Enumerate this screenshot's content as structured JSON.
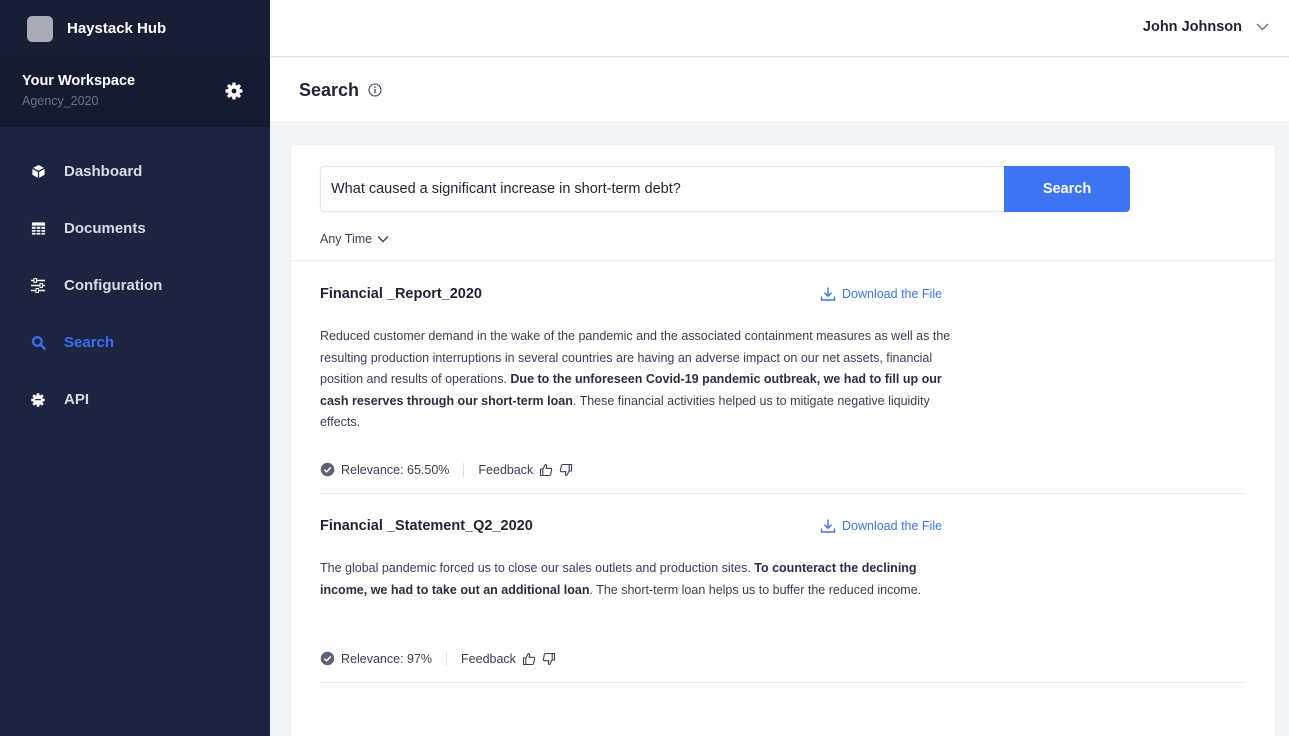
{
  "brand": {
    "name": "Haystack Hub"
  },
  "workspace": {
    "title": "Your Workspace",
    "subtitle": "Agency_2020"
  },
  "nav": [
    {
      "label": "Dashboard",
      "icon": "cube-icon"
    },
    {
      "label": "Documents",
      "icon": "table-icon"
    },
    {
      "label": "Configuration",
      "icon": "sliders-icon"
    },
    {
      "label": "Search",
      "icon": "search-icon",
      "active": true
    },
    {
      "label": "API",
      "icon": "gear-icon"
    }
  ],
  "user": {
    "name": "John Johnson"
  },
  "page": {
    "title": "Search"
  },
  "search": {
    "query": "What caused a significant increase in short-term debt?",
    "button_label": "Search",
    "time_filter": "Any Time"
  },
  "results": [
    {
      "title": "Financial _Report_2020",
      "download_label": "Download the File",
      "body_pre": "Reduced customer demand in the wake of the pandemic and the associated containment measures as well as the resulting production interruptions in several countries are having an adverse impact on our net assets, financial position and results of operations. ",
      "body_bold": "Due to the unforeseen Covid-19 pandemic outbreak, we had to fill up our cash reserves through our short-term loan",
      "body_post": ". These financial activities helped us to mitigate negative liquidity effects.",
      "relevance": "Relevance: 65.50%",
      "feedback_label": "Feedback"
    },
    {
      "title": "Financial _Statement_Q2_2020",
      "download_label": "Download the File",
      "body_pre": "The global pandemic forced us to close our sales outlets and production sites. ",
      "body_bold": "To counteract the declining income, we had to take out an additional loan",
      "body_post": ". The short-term loan helps us to buffer the reduced income.",
      "relevance": "Relevance: 97%",
      "feedback_label": "Feedback"
    }
  ],
  "colors": {
    "sidebar": "#1c2440",
    "accent": "#3d74f6",
    "active_nav": "#3b6cf5"
  }
}
